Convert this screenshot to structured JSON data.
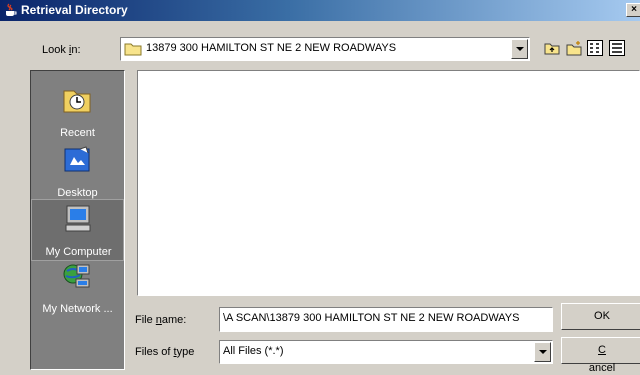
{
  "window": {
    "title": "Retrieval Directory",
    "close_glyph": "×"
  },
  "look_in": {
    "label_before": "Look ",
    "label_accel": "i",
    "label_after": "n:",
    "value": "13879 300 HAMILTON ST NE 2 NEW ROADWAYS"
  },
  "toolbar": {
    "icons": [
      "up-one-level-icon",
      "new-folder-icon",
      "list-view-icon",
      "details-view-icon"
    ]
  },
  "places": [
    {
      "label": "Recent",
      "icon": "recent-clock-icon"
    },
    {
      "label": "Desktop",
      "icon": "desktop-icon"
    },
    {
      "label": "My Computer",
      "icon": "computer-icon"
    },
    {
      "label": "My Network ...",
      "icon": "network-icon"
    }
  ],
  "file_name": {
    "label_before": "File ",
    "label_accel": "n",
    "label_after": "ame:",
    "value": "\\A SCAN\\13879 300 HAMILTON ST NE 2 NEW ROADWAYS"
  },
  "files_of_type": {
    "label_before": "Files of ",
    "label_accel": "t",
    "label_after": "ype",
    "value": "All Files (*.*)"
  },
  "buttons": {
    "ok": "OK",
    "cancel_accel": "C",
    "cancel_rest": "ancel"
  },
  "colors": {
    "title_start": "#0a246a",
    "title_end": "#a6caf0",
    "face": "#d4d0c8",
    "places_bg": "#808080"
  }
}
